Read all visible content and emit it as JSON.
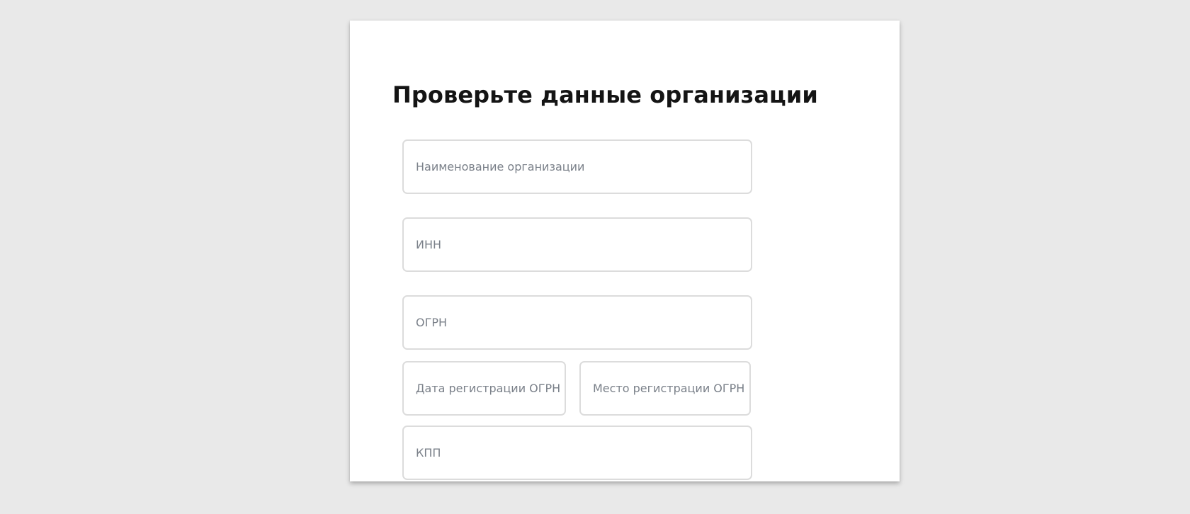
{
  "form": {
    "title": "Проверьте данные организации",
    "fields": [
      {
        "id": "org_name",
        "label": "Наименование организации",
        "value": ""
      },
      {
        "id": "inn",
        "label": "ИНН",
        "value": ""
      },
      {
        "id": "ogrn",
        "label": "ОГРН",
        "value": ""
      },
      {
        "id": "ogrn_date",
        "label": "Дата регистрации ОГРН",
        "value": ""
      },
      {
        "id": "ogrn_place",
        "label": "Место регистрации ОГРН",
        "value": ""
      },
      {
        "id": "kpp",
        "label": "КПП",
        "value": ""
      }
    ]
  },
  "colors": {
    "page_background": "#e9e9e9",
    "card_background": "#ffffff",
    "title_text": "#141414",
    "field_border": "#dcdcdc",
    "field_label": "#7a8089"
  }
}
